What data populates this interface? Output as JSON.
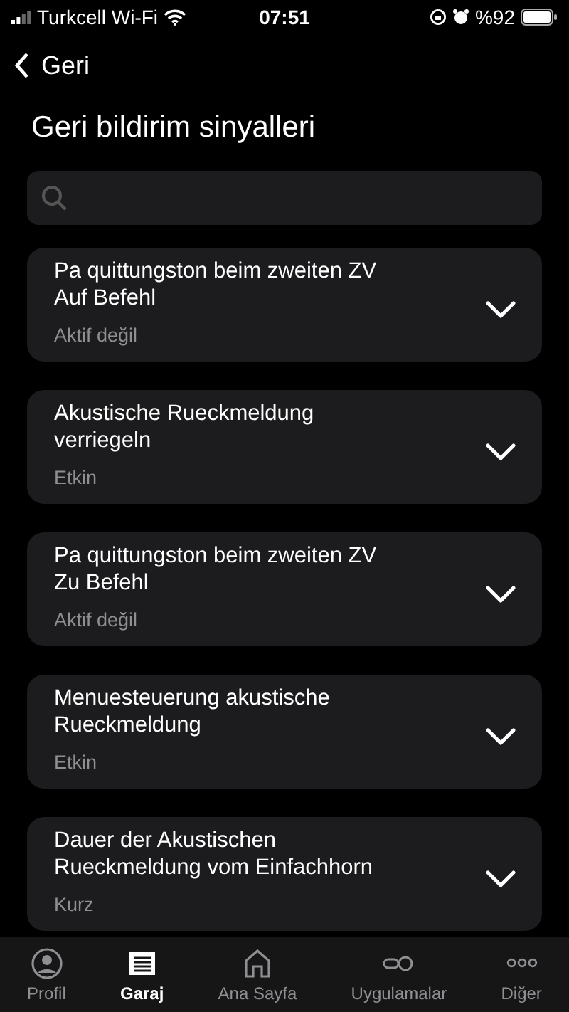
{
  "status_bar": {
    "carrier": "Turkcell Wi-Fi",
    "time": "07:51",
    "battery": "%92"
  },
  "nav": {
    "back": "Geri"
  },
  "title": "Geri bildirim sinyalleri",
  "settings": [
    {
      "title": "Pa quittungston beim zweiten ZV\nAuf Befehl",
      "value": "Aktif değil"
    },
    {
      "title": "Akustische Rueckmeldung\nverriegeln",
      "value": "Etkin"
    },
    {
      "title": "Pa quittungston beim zweiten ZV\nZu Befehl",
      "value": "Aktif değil"
    },
    {
      "title": "Menuesteuerung akustische\nRueckmeldung",
      "value": "Etkin"
    },
    {
      "title": "Dauer der Akustischen\nRueckmeldung vom Einfachhorn",
      "value": "Kurz"
    }
  ],
  "tab_bar": [
    {
      "label": "Profil",
      "kind": "profile",
      "selected": false
    },
    {
      "label": "Garaj",
      "kind": "garage",
      "selected": true
    },
    {
      "label": "Ana Sayfa",
      "kind": "home",
      "selected": false
    },
    {
      "label": "Uygulamalar",
      "kind": "apps",
      "selected": false
    },
    {
      "label": "Diğer",
      "kind": "more",
      "selected": false
    }
  ]
}
